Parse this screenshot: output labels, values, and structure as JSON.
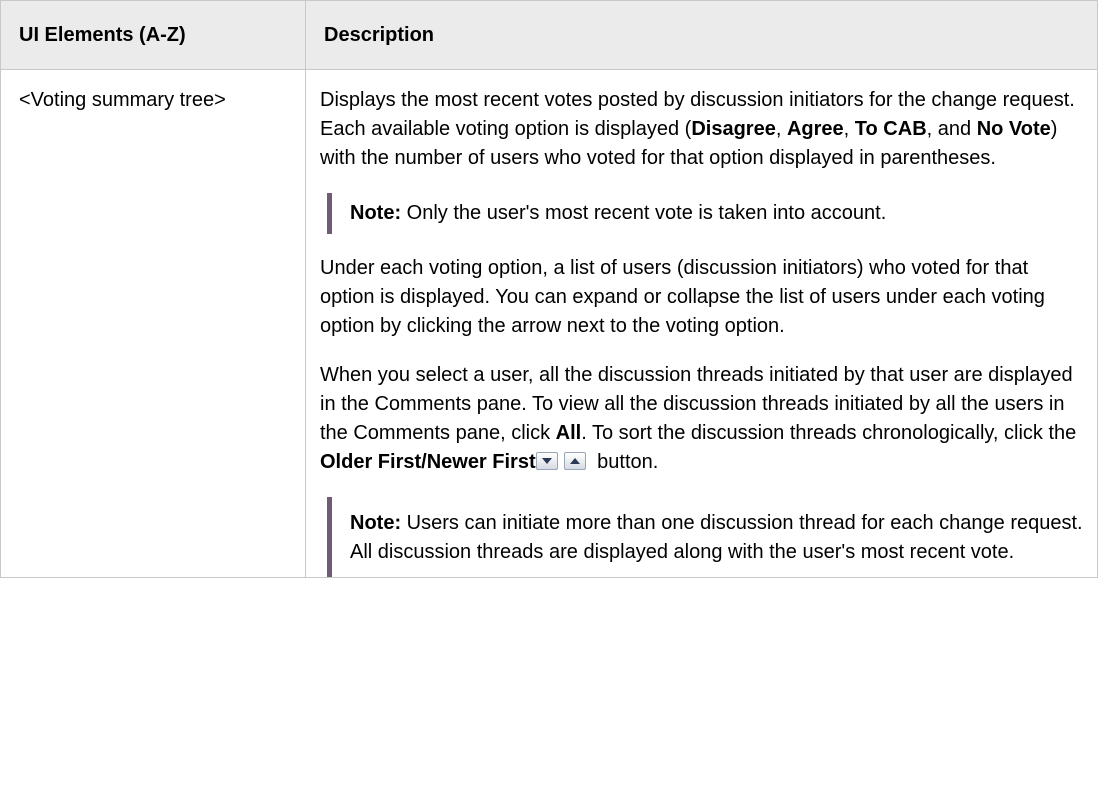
{
  "table": {
    "headers": [
      "UI Elements (A-Z)",
      "Description"
    ],
    "row": {
      "element": "<Voting summary tree>",
      "p1": {
        "t1": "Displays the most recent votes posted by discussion initiators for the change request. Each available voting option is displayed (",
        "b1": "Disagree",
        "t2": ", ",
        "b2": "Agree",
        "t3": ", ",
        "b3": "To CAB",
        "t4": ", and ",
        "b4": "No Vote",
        "t5": ") with the number of users who voted for that option displayed in parentheses."
      },
      "note1": {
        "label": "Note:",
        "text": " Only the user's most recent vote is taken into account."
      },
      "p2": "Under each voting option, a list of users (discussion initiators) who voted for that option is displayed. You can expand or collapse the list of users under each voting option by clicking the arrow next to the voting option.",
      "p3": {
        "t1": "When you select a user, all the discussion threads initiated by that user are displayed in the Comments pane. To view all the discussion threads initiated by all the users in the Comments pane, click ",
        "b1": "All",
        "t2": ". To sort the discussion threads chronologically, click the ",
        "b2": "Older First/Newer First",
        "t3": " button."
      },
      "note2": {
        "label": "Note:",
        "text": " Users can initiate more than one discussion thread for each change request. All discussion threads are displayed along with the user's most recent vote."
      }
    }
  },
  "icons": {
    "older_first": "sort-down-arrow-icon",
    "newer_first": "sort-up-arrow-icon"
  },
  "colors": {
    "header_bg": "#ebebeb",
    "border": "#c8c8c8",
    "note_bar": "#705a76"
  }
}
